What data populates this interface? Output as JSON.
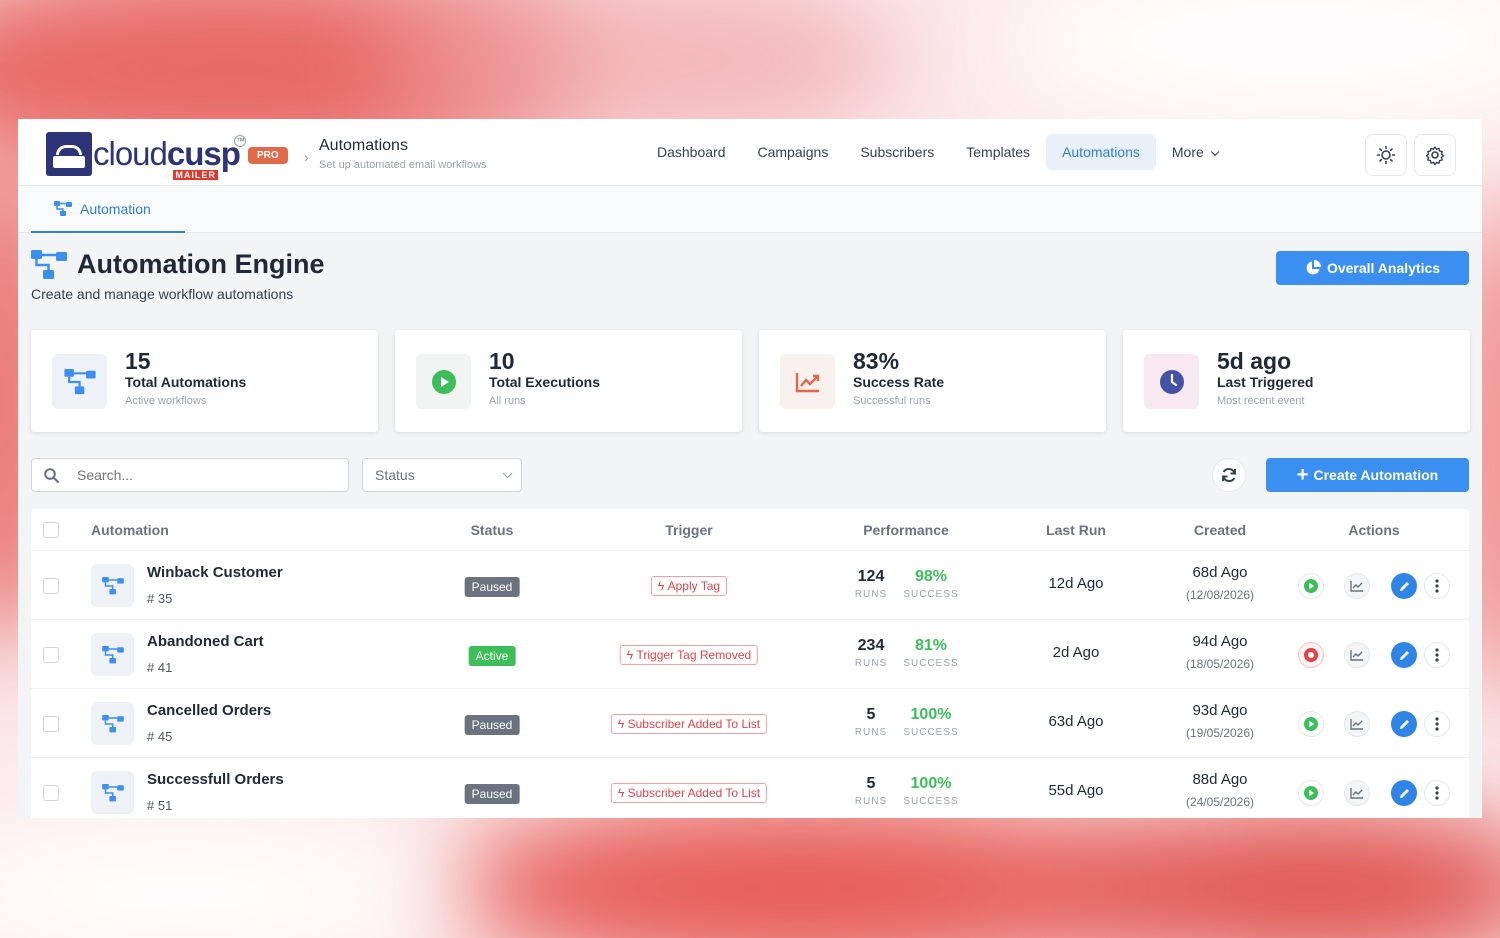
{
  "brand": {
    "logo_text_a": "cloud",
    "logo_text_b": "cusp",
    "logo_sub": "MAILER",
    "plan_badge": "PRO"
  },
  "breadcrumb": {
    "title": "Automations",
    "subtitle": "Set up automated email workflows"
  },
  "nav": {
    "items": [
      "Dashboard",
      "Campaigns",
      "Subscribers",
      "Templates",
      "Automations",
      "More"
    ],
    "active": "Automations"
  },
  "tabs": {
    "active_label": "Automation"
  },
  "page": {
    "title": "Automation Engine",
    "subtitle": "Create and manage workflow automations",
    "analytics_button": "Overall Analytics"
  },
  "stats": [
    {
      "value": "15",
      "label": "Total Automations",
      "sub": "Active workflows",
      "icon": "workflow-icon",
      "color": "#3b8ff0"
    },
    {
      "value": "10",
      "label": "Total Executions",
      "sub": "All runs",
      "icon": "play-icon",
      "color": "#3ebd5b"
    },
    {
      "value": "83%",
      "label": "Success Rate",
      "sub": "Successful runs",
      "icon": "trend-icon",
      "color": "#e0694a"
    },
    {
      "value": "5d ago",
      "label": "Last Triggered",
      "sub": "Most recent event",
      "icon": "clock-icon",
      "color": "#4552a8"
    }
  ],
  "toolbar": {
    "search_placeholder": "Search...",
    "status_label": "Status",
    "create_button": "Create Automation"
  },
  "table": {
    "headers": [
      "Automation",
      "Status",
      "Trigger",
      "Performance",
      "Last Run",
      "Created",
      "Actions"
    ],
    "runs_label": "RUNS",
    "success_label": "SUCCESS",
    "rows": [
      {
        "name": "Winback Customer",
        "id": "# 35",
        "status": "Paused",
        "trigger": "Apply Tag",
        "runs": "124",
        "success": "98%",
        "last_run": "12d Ago",
        "created": "68d Ago",
        "created_date": "(12/08/2026)",
        "primary_action": "play"
      },
      {
        "name": "Abandoned Cart",
        "id": "# 41",
        "status": "Active",
        "trigger": "Trigger Tag Removed",
        "runs": "234",
        "success": "81%",
        "last_run": "2d Ago",
        "created": "94d Ago",
        "created_date": "(18/05/2026)",
        "primary_action": "stop"
      },
      {
        "name": "Cancelled Orders",
        "id": "# 45",
        "status": "Paused",
        "trigger": "Subscriber Added To List",
        "runs": "5",
        "success": "100%",
        "last_run": "63d Ago",
        "created": "93d Ago",
        "created_date": "(19/05/2026)",
        "primary_action": "play"
      },
      {
        "name": "Successfull Orders",
        "id": "# 51",
        "status": "Paused",
        "trigger": "Subscriber Added To List",
        "runs": "5",
        "success": "100%",
        "last_run": "55d Ago",
        "created": "88d Ago",
        "created_date": "(24/05/2026)",
        "primary_action": "play"
      }
    ]
  },
  "colors": {
    "accent": "#3b8ff0",
    "success": "#3ebd5b",
    "danger": "#e0434a",
    "muted": "#6b7280"
  }
}
